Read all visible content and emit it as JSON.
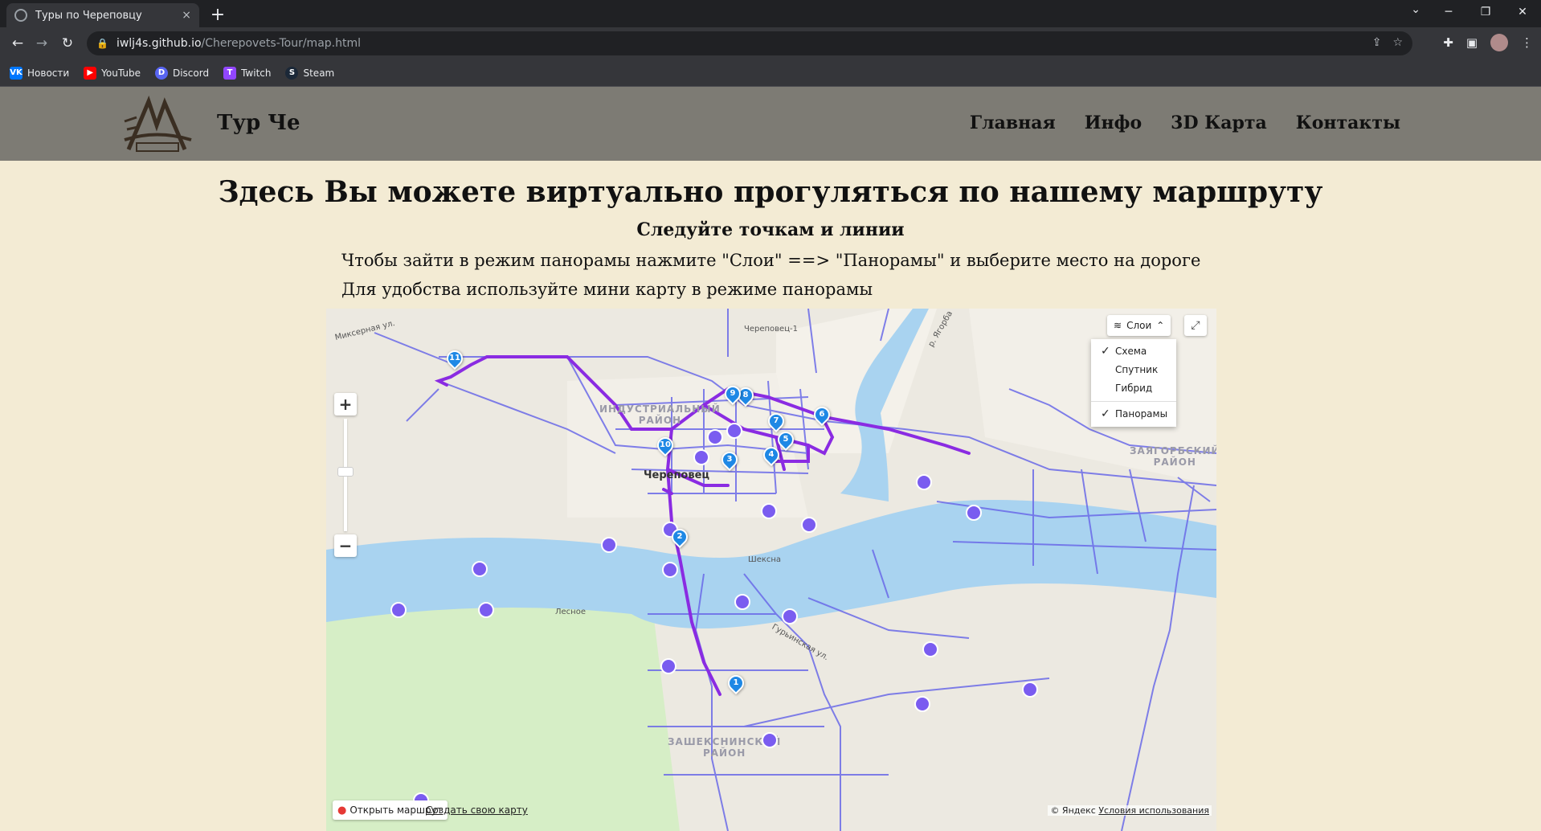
{
  "browser": {
    "tab_title": "Туры по Череповцу",
    "tab_close": "×",
    "new_tab": "+",
    "url_host": "iwlj4s.github.io",
    "url_path": "/Cherepovets-Tour/map.html",
    "bookmarks": [
      {
        "label": "Новости",
        "icon": "vk-icon",
        "color": "#0077ff",
        "glyph": "VK"
      },
      {
        "label": "YouTube",
        "icon": "youtube-icon",
        "color": "#ff0000",
        "glyph": "▶"
      },
      {
        "label": "Discord",
        "icon": "discord-icon",
        "color": "#5865f2",
        "glyph": "D"
      },
      {
        "label": "Twitch",
        "icon": "twitch-icon",
        "color": "#9146ff",
        "glyph": "T"
      },
      {
        "label": "Steam",
        "icon": "steam-icon",
        "color": "#1b2838",
        "glyph": "S"
      }
    ]
  },
  "site": {
    "brand": "Тур Че",
    "nav": [
      "Главная",
      "Инфо",
      "3D Карта",
      "Контакты"
    ],
    "title": "Здесь Вы можете виртуально прогуляться по нашему маршруту",
    "subtitle": "Следуйте точкам и линии",
    "note1": "Чтобы зайти в режим панорамы нажмите \"Слои\" ==> \"Панорамы\" и выберите место на дороге",
    "note2": "Для удобства используйте мини карту в режиме панорамы"
  },
  "map": {
    "layers_label": "Слои",
    "layers_menu": [
      {
        "label": "Схема",
        "checked": true
      },
      {
        "label": "Спутник",
        "checked": false
      },
      {
        "label": "Гибрид",
        "checked": false
      },
      {
        "label": "Панорамы",
        "checked": true
      }
    ],
    "zoom_in": "+",
    "zoom_out": "−",
    "open_route": "Открыть маршрут",
    "create_map": "Создать свою карту",
    "copyright_prefix": "© Яндекс",
    "terms": "Условия использования",
    "labels": {
      "mikserna": "Миксерная ул.",
      "sheksna": "Шексна",
      "lesnoe": "Лесное",
      "cherepovets1": "Череповец-1",
      "yagorba": "р. Ягорба",
      "turinskaya": "Гурьинская ул.",
      "city": "Череповец",
      "district_industrial": "ИНДУСТРИАЛЬНЫЙ\nРАЙОН",
      "district_zashekn": "ЗАШЕКСНИНСКИЙ\nРАЙОН",
      "district_zyagorb": "ЗАЯГОРБСКИЙ\nРАЙОН"
    },
    "markers": [
      "1",
      "2",
      "3",
      "4",
      "5",
      "6",
      "7",
      "8",
      "9",
      "10",
      "11"
    ]
  }
}
